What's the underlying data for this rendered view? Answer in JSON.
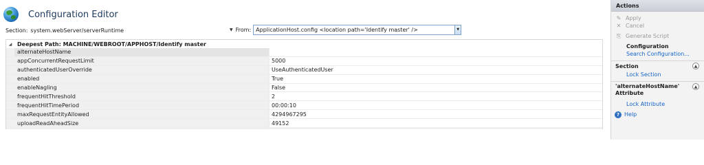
{
  "editor": {
    "title": "Configuration Editor",
    "section_label": "Section:",
    "section_value": "system.webServer/serverRuntime",
    "from_label": "From:",
    "from_value": "ApplicationHost.config <location path='Identify master' />"
  },
  "grid": {
    "group_header": "Deepest Path: MACHINE/WEBROOT/APPHOST/Identify master",
    "rows": [
      {
        "name": "alternateHostName",
        "value": ""
      },
      {
        "name": "appConcurrentRequestLimit",
        "value": "5000"
      },
      {
        "name": "authenticatedUserOverride",
        "value": "UseAuthenticatedUser"
      },
      {
        "name": "enabled",
        "value": "True"
      },
      {
        "name": "enableNagling",
        "value": "False"
      },
      {
        "name": "frequentHitThreshold",
        "value": "2"
      },
      {
        "name": "frequentHitTimePeriod",
        "value": "00:00:10"
      },
      {
        "name": "maxRequestEntityAllowed",
        "value": "4294967295"
      },
      {
        "name": "uploadReadAheadSize",
        "value": "49152"
      }
    ]
  },
  "actions": {
    "title": "Actions",
    "apply": "Apply",
    "cancel": "Cancel",
    "generate_script": "Generate Script",
    "configuration": "Configuration",
    "search_configuration": "Search Configuration...",
    "section_title": "Section",
    "lock_section": "Lock Section",
    "attribute_title": "'alternateHostName' Attribute",
    "lock_attribute": "Lock Attribute",
    "help": "Help"
  }
}
